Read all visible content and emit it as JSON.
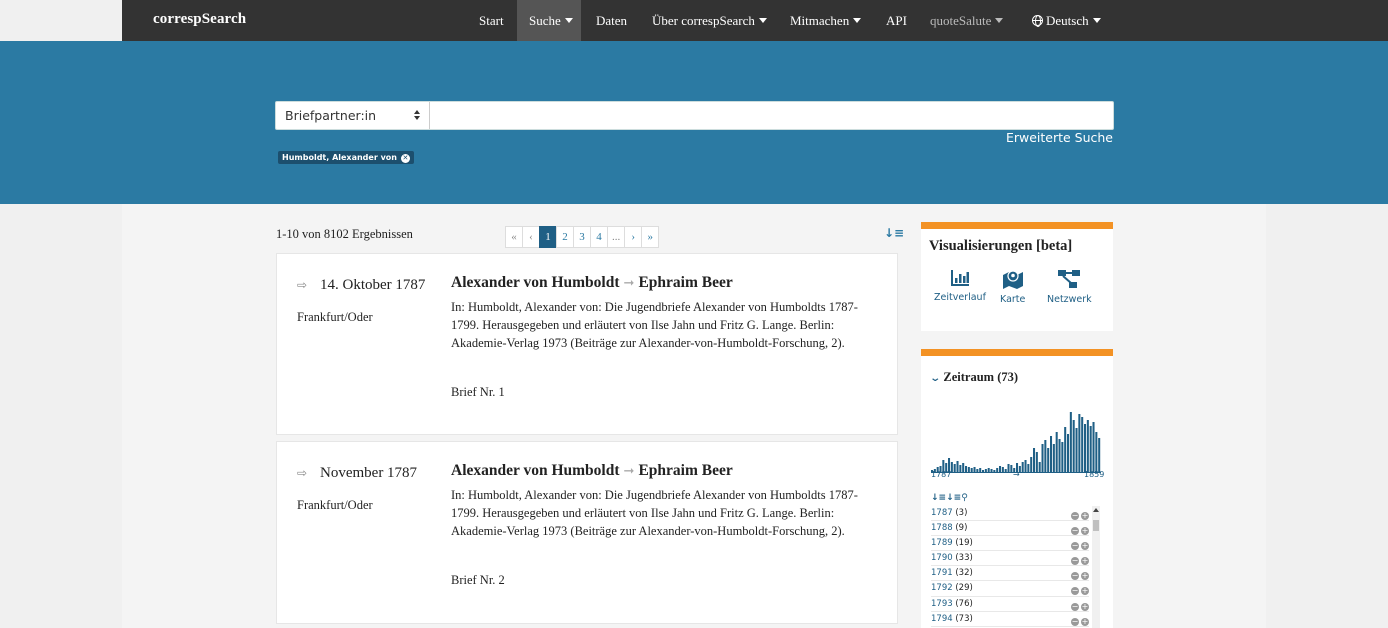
{
  "navbar": {
    "brand": "correspSearch",
    "items": [
      {
        "label": "Start"
      },
      {
        "label": "Suche"
      },
      {
        "label": "Daten"
      },
      {
        "label": "Über correspSearch"
      },
      {
        "label": "Mitmachen"
      },
      {
        "label": "API"
      },
      {
        "label": "quoteSalute"
      },
      {
        "label": "Deutsch"
      }
    ]
  },
  "search": {
    "select_value": "Briefpartner:in",
    "input_value": "",
    "advanced_label": "Erweiterte Suche",
    "filter_tag": "Humboldt, Alexander von"
  },
  "results": {
    "count_text": "1-10 von 8102 Ergebnissen",
    "pagination": [
      "«",
      "‹",
      "1",
      "2",
      "3",
      "4",
      "...",
      "›",
      "»"
    ],
    "sort_icon": "sort-icon",
    "cards": [
      {
        "date": "14. Oktober 1787",
        "place": "Frankfurt/Oder",
        "sender": "Alexander von Humboldt",
        "receiver": "Ephraim Beer",
        "source": "In: Humboldt, Alexander von: Die Jugendbriefe Alexander von Humboldts 1787-1799. Herausgegeben und erläutert von Ilse Jahn und Fritz G. Lange. Berlin: Akademie-Verlag 1973 (Beiträge zur Alexander-von-Humboldt-Forschung, 2).",
        "number": "Brief Nr. 1"
      },
      {
        "date": "November 1787",
        "place": "Frankfurt/Oder",
        "sender": "Alexander von Humboldt",
        "receiver": "Ephraim Beer",
        "source": "In: Humboldt, Alexander von: Die Jugendbriefe Alexander von Humboldts 1787-1799. Herausgegeben und erläutert von Ilse Jahn und Fritz G. Lange. Berlin: Akademie-Verlag 1973 (Beiträge zur Alexander-von-Humboldt-Forschung, 2).",
        "number": "Brief Nr. 2"
      }
    ]
  },
  "sidebar": {
    "vis_title": "Visualisierungen [beta]",
    "vis_items": [
      {
        "label": "Zeitverlauf",
        "icon": "bar-chart-icon"
      },
      {
        "label": "Karte",
        "icon": "map-icon"
      },
      {
        "label": "Netzwerk",
        "icon": "network-icon"
      }
    ],
    "zeitraum_title": "Zeitraum (73)",
    "hist_start": "1787",
    "hist_arrow": "→",
    "hist_end": "1859",
    "years": [
      {
        "year": "1787",
        "count": "(3)"
      },
      {
        "year": "1788",
        "count": "(9)"
      },
      {
        "year": "1789",
        "count": "(19)"
      },
      {
        "year": "1790",
        "count": "(33)"
      },
      {
        "year": "1791",
        "count": "(32)"
      },
      {
        "year": "1792",
        "count": "(29)"
      },
      {
        "year": "1793",
        "count": "(76)"
      },
      {
        "year": "1794",
        "count": "(73)"
      }
    ]
  },
  "colors": {
    "navbar": "#333333",
    "hero": "#2b7aa3",
    "accent": "#f39224",
    "link": "#1f5f85"
  }
}
